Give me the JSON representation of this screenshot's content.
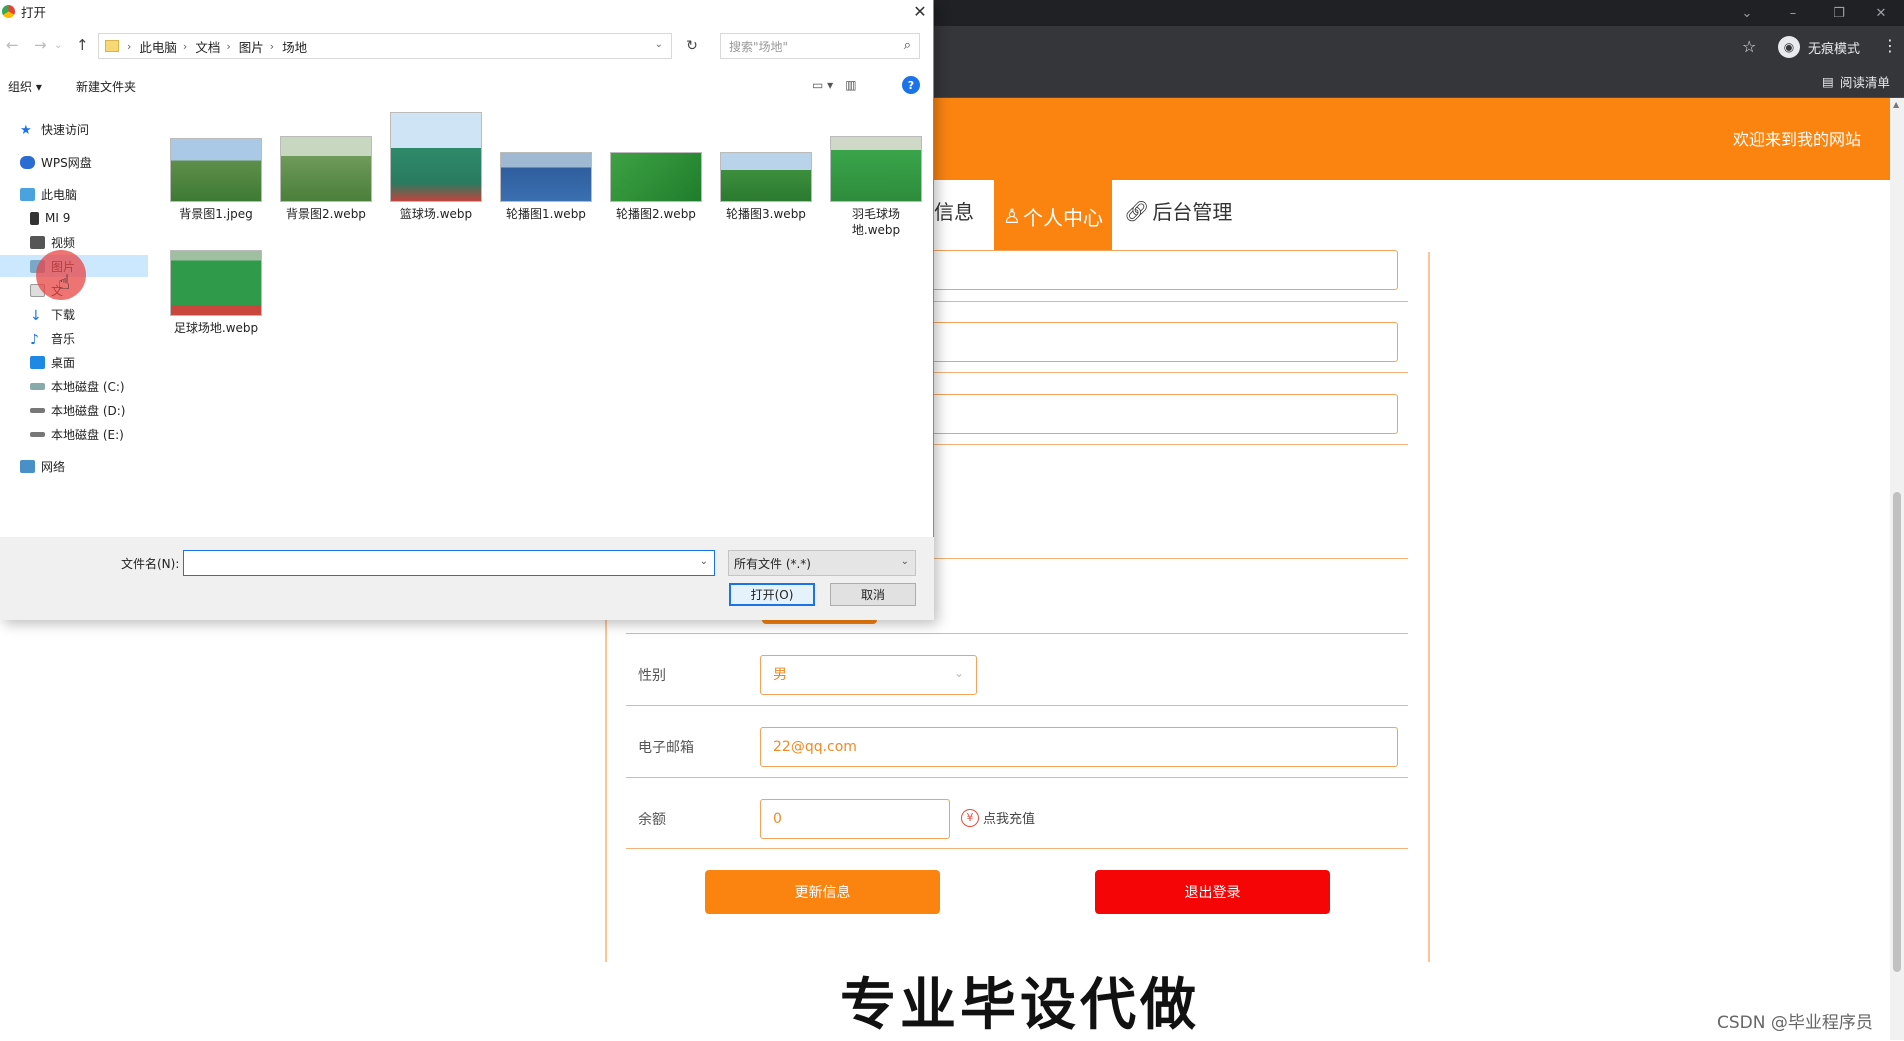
{
  "dialog": {
    "title": "打开",
    "breadcrumb": [
      "此电脑",
      "文档",
      "图片",
      "场地"
    ],
    "search_placeholder": "搜索\"场地\"",
    "organize": "组织 ▾",
    "new_folder": "新建文件夹",
    "nav": {
      "quick_access": "快速访问",
      "wps": "WPS网盘",
      "this_pc": "此电脑",
      "mi9": "MI 9",
      "videos": "视频",
      "pictures": "图片",
      "documents": "文",
      "downloads": "下载",
      "music": "音乐",
      "desktop": "桌面",
      "disk_c": "本地磁盘 (C:)",
      "disk_d": "本地磁盘 (D:)",
      "disk_e": "本地磁盘 (E:)",
      "network": "网络"
    },
    "files": [
      "背景图1.jpeg",
      "背景图2.webp",
      "篮球场.webp",
      "轮播图1.webp",
      "轮播图2.webp",
      "轮播图3.webp",
      "羽毛球场地.webp",
      "足球场地.webp"
    ],
    "filename_label": "文件名(N):",
    "filename_value": "",
    "filetype": "所有文件 (*.*)",
    "open_button": "打开(O)",
    "cancel_button": "取消"
  },
  "browser": {
    "incognito_label": "无痕模式",
    "reading_list": "阅读清单"
  },
  "site": {
    "welcome": "欢迎来到我的网站",
    "nav_partial": "信息",
    "tab_personal": "个人中心",
    "tab_admin": "后台管理",
    "gender_label": "性别",
    "gender_value": "男",
    "email_label": "电子邮箱",
    "email_value": "22@qq.com",
    "balance_label": "余额",
    "balance_value": "0",
    "recharge": "点我充值",
    "update_button": "更新信息",
    "logout_button": "退出登录",
    "accent_color": "#fb8410",
    "danger_color": "#f50505"
  },
  "overlay": {
    "caption": "专业毕设代做",
    "watermark": "CSDN @毕业程序员"
  }
}
